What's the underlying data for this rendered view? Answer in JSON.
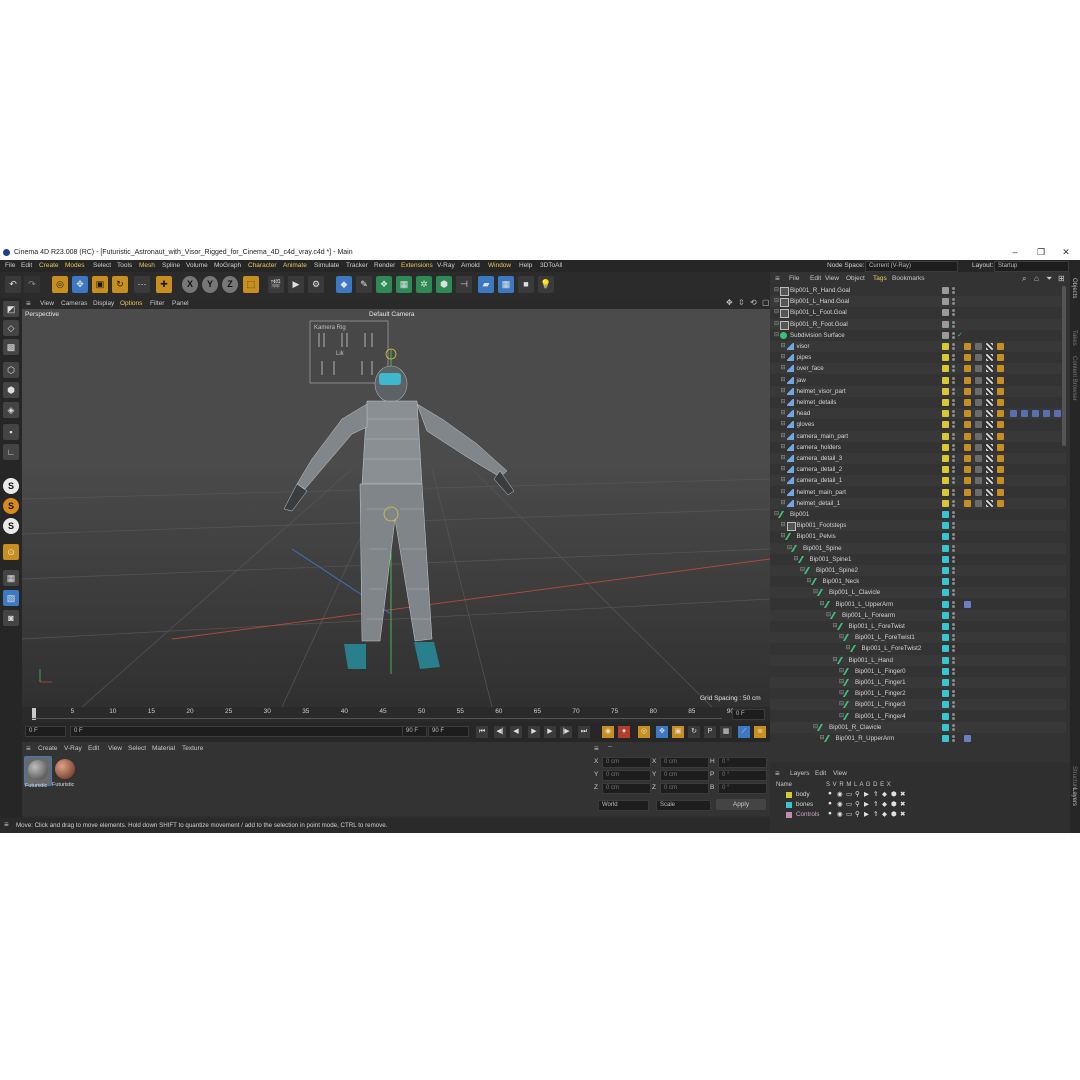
{
  "window": {
    "title": "Cinema 4D R23.008 (RC) - [Futuristic_Astronaut_with_Visor_Rigged_for_Cinema_4D_c4d_vray.c4d *] - Main",
    "minimize": "–",
    "maximize": "❐",
    "close": "✕"
  },
  "menu": [
    "File",
    "Edit",
    "Create",
    "Modes",
    "Select",
    "Tools",
    "Mesh",
    "Spline",
    "Volume",
    "MoGraph",
    "Character",
    "Animate",
    "Simulate",
    "Tracker",
    "Render",
    "Extensions",
    "V-Ray",
    "Arnold",
    "Window",
    "Help",
    "3DToAll"
  ],
  "node_space": {
    "label": "Node Space:",
    "value": "Current (V-Ray)"
  },
  "layout": {
    "label": "Layout:",
    "value": "Startup"
  },
  "viewport": {
    "menu": [
      "View",
      "Cameras",
      "Display",
      "Options",
      "Filter",
      "Panel"
    ],
    "projection": "Perspective",
    "camera": "Default Camera ",
    "grid_spacing": "Grid Spacing : 50 cm",
    "panel_text_1": "Kamera  Rig",
    "panel_text_2": "Lik"
  },
  "timeline": {
    "ticks": [
      "0",
      "5",
      "10",
      "15",
      "20",
      "25",
      "30",
      "35",
      "40",
      "45",
      "50",
      "55",
      "60",
      "65",
      "70",
      "75",
      "80",
      "85",
      "90"
    ],
    "frame_end": "0 F",
    "current_start": "0 F",
    "current_field": "0 F",
    "end_field_1": "90 F",
    "end_field_2": "90 F"
  },
  "materials": {
    "menu": [
      "Create",
      "V-Ray",
      "Edit",
      "View",
      "Select",
      "Material",
      "Texture"
    ],
    "items": [
      {
        "label": "Futuristic",
        "color": "#6a6a6a"
      },
      {
        "label": "Futuristic",
        "color": "#a0573c"
      }
    ]
  },
  "coords": {
    "header": "--",
    "rows": [
      {
        "a": "X",
        "av": "0 cm",
        "b": "X",
        "bv": "0 cm",
        "c": "H",
        "cv": "0 °"
      },
      {
        "a": "Y",
        "av": "0 cm",
        "b": "Y",
        "bv": "0 cm",
        "c": "P",
        "cv": "0 °"
      },
      {
        "a": "Z",
        "av": "0 cm",
        "b": "Z",
        "bv": "0 cm",
        "c": "B",
        "cv": "0 °"
      }
    ],
    "world": "World",
    "scale": "Scale",
    "apply": "Apply"
  },
  "status": "Move: Click and drag to move elements. Hold down SHIFT to quantize movement / add to the selection in point mode, CTRL to remove.",
  "objects_panel": {
    "menu": [
      "File",
      "Edit",
      "View",
      "Object",
      "Tags",
      "Bookmarks"
    ],
    "rows": [
      {
        "name": "Bip001_R_Hand.Goal",
        "indent": 0,
        "kind": "goal",
        "color": "#9a9a9a"
      },
      {
        "name": "Bip001_L_Hand.Goal",
        "indent": 0,
        "kind": "goal",
        "color": "#9a9a9a"
      },
      {
        "name": "Bip001_L_Foot.Goal",
        "indent": 0,
        "kind": "goal",
        "color": "#9a9a9a"
      },
      {
        "name": "Bip001_R_Foot.Goal",
        "indent": 0,
        "kind": "goal",
        "color": "#9a9a9a"
      },
      {
        "name": "Subdivision Surface",
        "indent": 0,
        "kind": "sds",
        "color": "#9a9a9a"
      },
      {
        "name": "visor",
        "indent": 1,
        "kind": "mesh",
        "color": "#d8c934",
        "tags": true
      },
      {
        "name": "pipes",
        "indent": 1,
        "kind": "mesh",
        "color": "#d8c934",
        "tags": true
      },
      {
        "name": "over_face",
        "indent": 1,
        "kind": "mesh",
        "color": "#d8c934",
        "tags": true
      },
      {
        "name": "jaw",
        "indent": 1,
        "kind": "mesh",
        "color": "#d8c934",
        "tags": true
      },
      {
        "name": "helmet_visor_part",
        "indent": 1,
        "kind": "mesh",
        "color": "#d8c934",
        "tags": true
      },
      {
        "name": "helmet_details",
        "indent": 1,
        "kind": "mesh",
        "color": "#d8c934",
        "tags": true
      },
      {
        "name": "head",
        "indent": 1,
        "kind": "mesh",
        "color": "#d8c934",
        "tags": "long"
      },
      {
        "name": "gloves",
        "indent": 1,
        "kind": "mesh",
        "color": "#d8c934",
        "tags": true
      },
      {
        "name": "camera_main_part",
        "indent": 1,
        "kind": "mesh",
        "color": "#d8c934",
        "tags": true
      },
      {
        "name": "camera_holders",
        "indent": 1,
        "kind": "mesh",
        "color": "#d8c934",
        "tags": true
      },
      {
        "name": "camera_detail_3",
        "indent": 1,
        "kind": "mesh",
        "color": "#d8c934",
        "tags": true
      },
      {
        "name": "camera_detail_2",
        "indent": 1,
        "kind": "mesh",
        "color": "#d8c934",
        "tags": true
      },
      {
        "name": "camera_detail_1",
        "indent": 1,
        "kind": "mesh",
        "color": "#d8c934",
        "tags": true
      },
      {
        "name": "helmet_main_part",
        "indent": 1,
        "kind": "mesh",
        "color": "#d8c934",
        "tags": true
      },
      {
        "name": "helmet_detail_1",
        "indent": 1,
        "kind": "mesh",
        "color": "#d8c934",
        "tags": true
      },
      {
        "name": "Bip001",
        "indent": 0,
        "kind": "bone",
        "color": "#38c4d0"
      },
      {
        "name": "Bip001_Footsteps",
        "indent": 1,
        "kind": "goal",
        "color": "#38c4d0"
      },
      {
        "name": "Bip001_Pelvis",
        "indent": 1,
        "kind": "bone",
        "color": "#38c4d0"
      },
      {
        "name": "Bip001_Spine",
        "indent": 2,
        "kind": "bone",
        "color": "#38c4d0"
      },
      {
        "name": "Bip001_Spine1",
        "indent": 3,
        "kind": "bone",
        "color": "#38c4d0"
      },
      {
        "name": "Bip001_Spine2",
        "indent": 4,
        "kind": "bone",
        "color": "#38c4d0"
      },
      {
        "name": "Bip001_Neck",
        "indent": 5,
        "kind": "bone",
        "color": "#38c4d0"
      },
      {
        "name": "Bip001_L_Clavicle",
        "indent": 6,
        "kind": "bone",
        "color": "#38c4d0"
      },
      {
        "name": "Bip001_L_UpperArm",
        "indent": 7,
        "kind": "bone",
        "color": "#38c4d0",
        "ik": true
      },
      {
        "name": "Bip001_L_Forearm",
        "indent": 8,
        "kind": "bone",
        "color": "#38c4d0"
      },
      {
        "name": "Bip001_L_ForeTwist",
        "indent": 9,
        "kind": "bone",
        "color": "#38c4d0"
      },
      {
        "name": "Bip001_L_ForeTwist1",
        "indent": 10,
        "kind": "bone",
        "color": "#38c4d0"
      },
      {
        "name": "Bip001_L_ForeTwist2",
        "indent": 11,
        "kind": "bone",
        "color": "#38c4d0"
      },
      {
        "name": "Bip001_L_Hand",
        "indent": 9,
        "kind": "bone",
        "color": "#38c4d0"
      },
      {
        "name": "Bip001_L_Finger0",
        "indent": 10,
        "kind": "bone",
        "color": "#38c4d0"
      },
      {
        "name": "Bip001_L_Finger1",
        "indent": 10,
        "kind": "bone",
        "color": "#38c4d0"
      },
      {
        "name": "Bip001_L_Finger2",
        "indent": 10,
        "kind": "bone",
        "color": "#38c4d0"
      },
      {
        "name": "Bip001_L_Finger3",
        "indent": 10,
        "kind": "bone",
        "color": "#38c4d0"
      },
      {
        "name": "Bip001_L_Finger4",
        "indent": 10,
        "kind": "bone",
        "color": "#38c4d0"
      },
      {
        "name": "Bip001_R_Clavicle",
        "indent": 6,
        "kind": "bone",
        "color": "#38c4d0"
      },
      {
        "name": "Bip001_R_UpperArm",
        "indent": 7,
        "kind": "bone",
        "color": "#38c4d0",
        "ik": true
      }
    ]
  },
  "layers_panel": {
    "menu": [
      "Layers",
      "Edit",
      "View"
    ],
    "header": {
      "name": "Name",
      "flags": "S V R M L A G D E X"
    },
    "rows": [
      {
        "name": "body",
        "color": "#d8c934"
      },
      {
        "name": "bones",
        "color": "#38c4d0"
      },
      {
        "name": "Controls",
        "color": "#c48ab0"
      }
    ]
  },
  "side_tabs": [
    "Objects",
    "Takes",
    "Content Browser",
    "Structure",
    "Layers",
    "Attributes"
  ]
}
